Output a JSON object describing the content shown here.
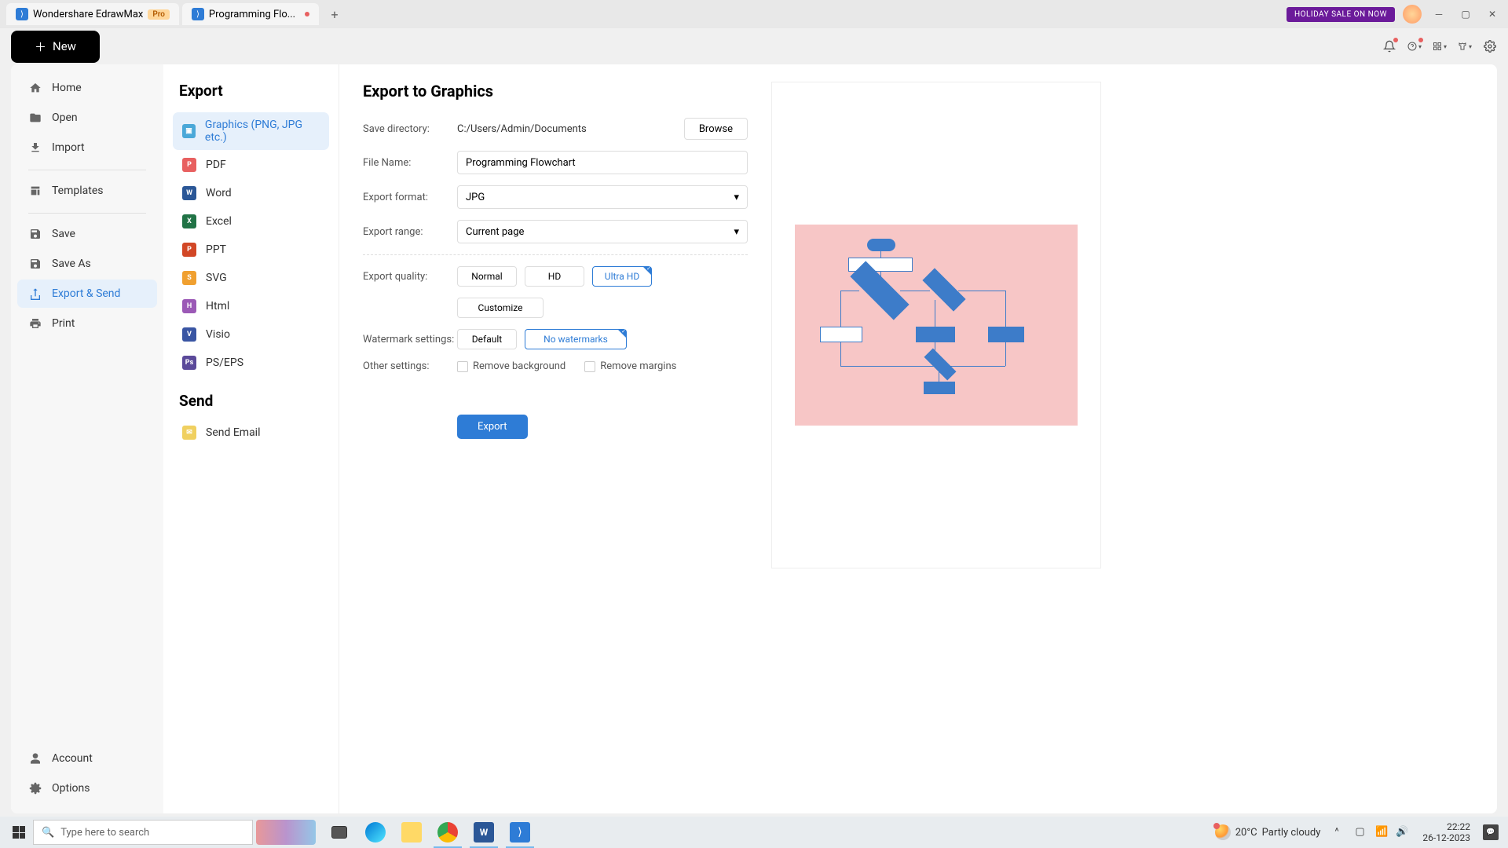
{
  "titlebar": {
    "app_name": "Wondershare EdrawMax",
    "pro_badge": "Pro",
    "doc_tab": "Programming Flo...",
    "holiday": "HOLIDAY SALE ON NOW"
  },
  "toolbar": {
    "new_label": "New"
  },
  "nav": {
    "home": "Home",
    "open": "Open",
    "import": "Import",
    "templates": "Templates",
    "save": "Save",
    "save_as": "Save As",
    "export_send": "Export & Send",
    "print": "Print",
    "account": "Account",
    "options": "Options"
  },
  "export": {
    "title": "Export",
    "graphics": "Graphics (PNG, JPG etc.)",
    "pdf": "PDF",
    "word": "Word",
    "excel": "Excel",
    "ppt": "PPT",
    "svg": "SVG",
    "html": "Html",
    "visio": "Visio",
    "ps": "PS/EPS",
    "send_title": "Send",
    "send_email": "Send Email"
  },
  "panel": {
    "title": "Export to Graphics",
    "save_dir_label": "Save directory:",
    "save_dir_value": "C:/Users/Admin/Documents",
    "browse": "Browse",
    "file_name_label": "File Name:",
    "file_name_value": "Programming Flowchart",
    "format_label": "Export format:",
    "format_value": "JPG",
    "range_label": "Export range:",
    "range_value": "Current page",
    "quality_label": "Export quality:",
    "quality_normal": "Normal",
    "quality_hd": "HD",
    "quality_uhd": "Ultra HD",
    "customize": "Customize",
    "watermark_label": "Watermark settings:",
    "watermark_default": "Default",
    "watermark_none": "No watermarks",
    "other_label": "Other settings:",
    "remove_bg": "Remove background",
    "remove_margins": "Remove margins",
    "export_btn": "Export"
  },
  "taskbar": {
    "search_placeholder": "Type here to search",
    "weather_temp": "20°C",
    "weather_desc": "Partly cloudy",
    "time": "22:22",
    "date": "26-12-2023"
  }
}
